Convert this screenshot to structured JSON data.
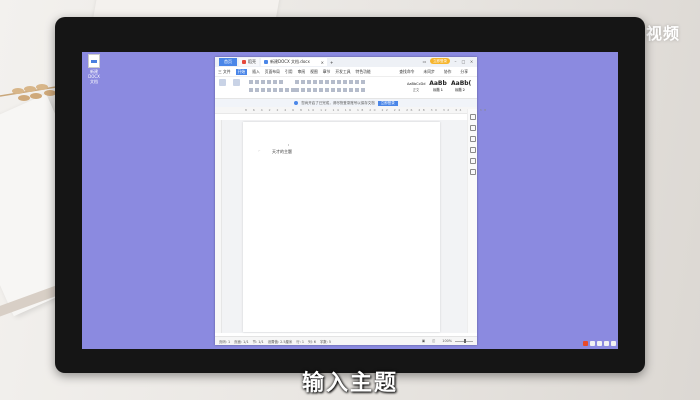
{
  "overlay": {
    "logo": "天奇·视频",
    "subtitle": "输入主题"
  },
  "desktop": {
    "icon_label": "新建DOCX 文档"
  },
  "window": {
    "tabs": {
      "home": "首页",
      "store": "稻壳",
      "doc": "新建DOCX 文档.docx"
    },
    "login_label": "立即登录",
    "menu": [
      "三 文件",
      "开始",
      "插入",
      "页面布局",
      "引用",
      "审阅",
      "视图",
      "章节",
      "开发工具",
      "特色功能"
    ],
    "menu_active_index": 1,
    "menu_right": [
      "查找命令",
      "未同步",
      "协作",
      "分享"
    ],
    "styles": [
      {
        "sample": "AaBbCcDd",
        "name": "正文"
      },
      {
        "sample": "AaBb",
        "name": "标题 1"
      },
      {
        "sample": "AaBb(",
        "name": "标题 2"
      }
    ],
    "notice": {
      "text": "您尚开启了已完成，请尽快登录账号以保存文档",
      "button": "立即登录"
    },
    "ruler_numbers": "8 6 4 2 2 4 6 8 10 12 14 16 18 20 22 24 26 28 30 32 34 36 38",
    "document": {
      "text": "天才的主题"
    },
    "status": {
      "page": "页码: 1",
      "pages": "页面: 1/1",
      "section": "节: 1/1",
      "settings": "设置值: 2.5厘米",
      "row": "行: 1",
      "col": "列: 6",
      "words": "字数: 5",
      "zoom": "100%"
    }
  },
  "colors": {
    "screen_bg": "#8b8ae0",
    "accent": "#4a86e8",
    "login": "#f6b52d"
  }
}
